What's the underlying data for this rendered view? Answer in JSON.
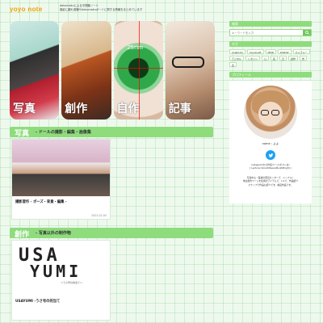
{
  "site": {
    "title": "yoyo note",
    "description_line1": "dokumakuによる中間報ノート",
    "description_line2": "撮影に趣れ実験やdokumakuボードに関する情報をまとめています"
  },
  "categories": [
    {
      "label": "写真"
    },
    {
      "label": "創作"
    },
    {
      "label": "自作"
    },
    {
      "label": "記事"
    }
  ],
  "eye_mm_label": "25mm",
  "sections": [
    {
      "title": "写真",
      "subtitle": "- ドールの撮影・編集・画像集"
    },
    {
      "title": "創作",
      "subtitle": "- 写真以外の制作物"
    }
  ],
  "posts": [
    {
      "title": "撮影習作 - ポーズ・背景・編集 -",
      "date": "2022.02.05"
    },
    {
      "title": "USAYUMI -うさ号の的当て",
      "date": ""
    }
  ],
  "logo": {
    "line1": "USA",
    "line2": "YUMI",
    "sub": "〜うさ号の的当て〜"
  },
  "sidebar": {
    "search_head": "検索",
    "search_placeholder": "キーワードを入力",
    "tags_head": "タグ",
    "tags": [
      "dollphoto",
      "handcraft",
      "MMD",
      "DWDW",
      "カメラルー",
      "デジタル",
      "レタリン",
      "公",
      "名",
      "日",
      "創作",
      "作",
      "表"
    ],
    "profile_head": "プロフィール",
    "profile_name": "name : よよ",
    "profile_links_line1": "Instagramから作画ページ(ポストは)",
    "profile_links_line2": "[ Lectora/ Smart/Peace/Build/Bright ]",
    "profile_desc_line1": "写真中心・医療の研究センターで、シンプル！",
    "profile_desc_line2": "他は創作ページを使用のアイテムで、1:1で、作品紹介",
    "profile_desc_line3": "スナップで作品も紹介です。動画作品です。"
  },
  "colors": {
    "accent": "#8fdc7d",
    "title": "#f1a000",
    "twitter": "#1da1f2"
  }
}
